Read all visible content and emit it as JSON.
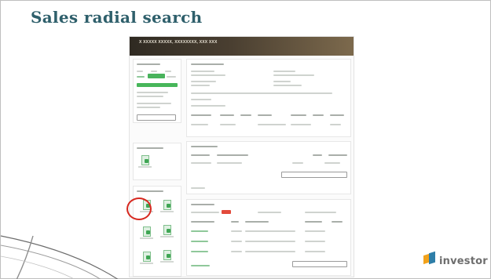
{
  "slide": {
    "title": "Sales radial search"
  },
  "screenshot": {
    "hero": {
      "address": "X XXXXX XXXXX, XXXXXXXX, XXX XXX",
      "subtitle": "",
      "right_text": ""
    },
    "icons": [
      "document-icon",
      "report-icon",
      "map-icon",
      "chart-icon"
    ],
    "highlight_color": "#d7281f"
  },
  "logo": {
    "top_text": "",
    "brand": "investor",
    "colors": [
      "#f2a21b",
      "#2e7ea8"
    ]
  }
}
